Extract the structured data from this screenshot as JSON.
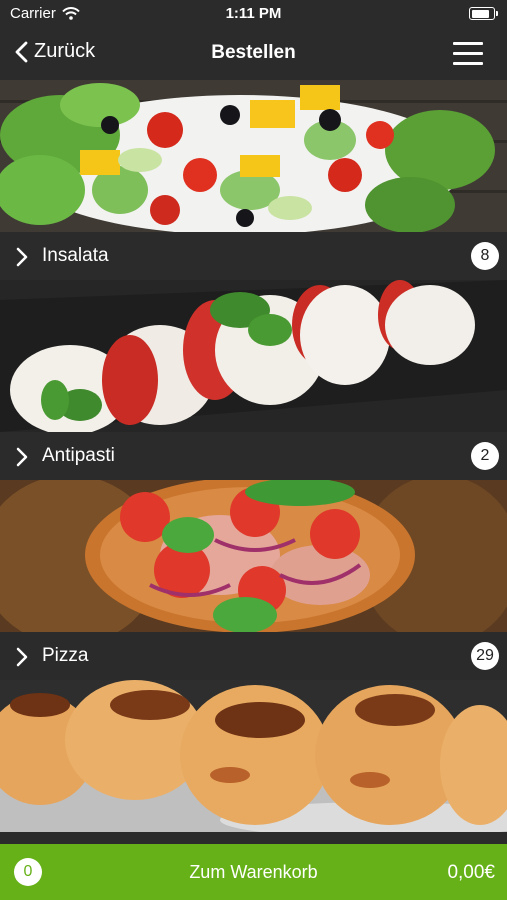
{
  "status_bar": {
    "carrier": "Carrier",
    "time": "1:11 PM",
    "battery_level": 0.95
  },
  "nav": {
    "back_label": "Zurück",
    "title": "Bestellen"
  },
  "categories": [
    {
      "label": "Insalata",
      "count": "8"
    },
    {
      "label": "Antipasti",
      "count": "2"
    },
    {
      "label": "Pizza",
      "count": "29"
    }
  ],
  "cart": {
    "count": "0",
    "label": "Zum Warenkorb",
    "total": "0,00€"
  },
  "colors": {
    "accent": "#66b118",
    "bar": "#2b2b2b"
  }
}
